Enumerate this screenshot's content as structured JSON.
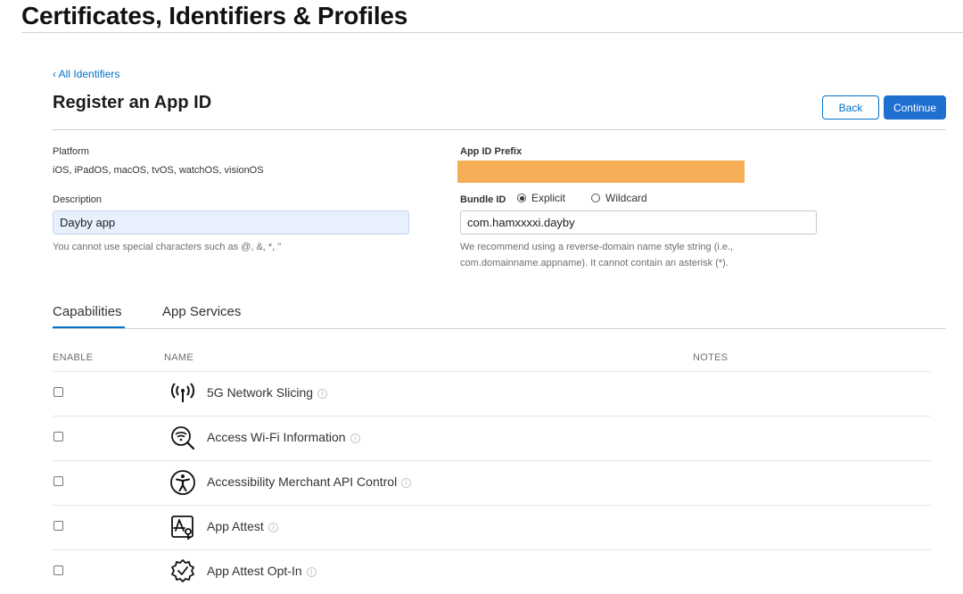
{
  "header": {
    "title": "Certificates, Identifiers & Profiles"
  },
  "nav": {
    "back_link": "‹ All Identifiers"
  },
  "section": {
    "title": "Register an App ID"
  },
  "actions": {
    "back_label": "Back",
    "continue_label": "Continue"
  },
  "form": {
    "platform_label": "Platform",
    "platform_value": "iOS, iPadOS, macOS, tvOS, watchOS, visionOS",
    "prefix_label": "App ID Prefix",
    "prefix_redaction_color": "#f5ae55",
    "description_label": "Description",
    "description_value": "Dayby app",
    "description_hint": "You cannot use special characters such as @, &, *, \"",
    "bundle_label": "Bundle ID",
    "bundle_options": [
      {
        "label": "Explicit",
        "selected": true
      },
      {
        "label": "Wildcard",
        "selected": false
      }
    ],
    "bundle_value": "com.hamxxxxi.dayby",
    "bundle_hint_line1": "We recommend using a reverse-domain name style string (i.e.,",
    "bundle_hint_line2": "com.domainname.appname). It cannot contain an asterisk (*)."
  },
  "tabs": [
    {
      "label": "Capabilities",
      "active": true
    },
    {
      "label": "App Services",
      "active": false
    }
  ],
  "table": {
    "headers": {
      "enable": "ENABLE",
      "name": "NAME",
      "notes": "NOTES"
    },
    "rows": [
      {
        "name": "5G Network Slicing",
        "icon": "antenna-icon",
        "enabled": false
      },
      {
        "name": "Access Wi-Fi Information",
        "icon": "wifi-search-icon",
        "enabled": false
      },
      {
        "name": "Accessibility Merchant API Control",
        "icon": "accessibility-icon",
        "enabled": false
      },
      {
        "name": "App Attest",
        "icon": "app-store-key-icon",
        "enabled": false
      },
      {
        "name": "App Attest Opt-In",
        "icon": "badge-check-icon",
        "enabled": false
      }
    ]
  },
  "accent_color": "#0070c9"
}
